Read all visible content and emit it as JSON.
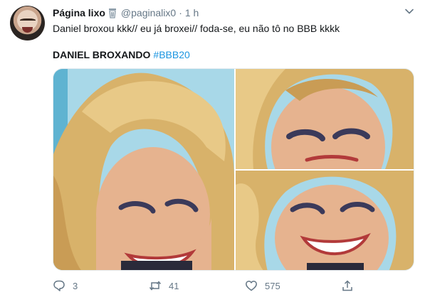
{
  "tweet": {
    "display_name": "Página lixo",
    "handle": "@paginalix0",
    "separator": "·",
    "time": "1 h",
    "text": "Daniel broxou kkk// eu já broxei// foda-se, eu não tô no BBB kkkk",
    "caption_bold": "DANIEL BROXANDO",
    "caption_hashtag": "#BBB20"
  },
  "actions": {
    "replies": "3",
    "retweets": "41",
    "likes": "575"
  },
  "icons": {
    "name_badge": "trash-can-icon",
    "menu": "chevron-down-icon",
    "reply": "reply-icon",
    "retweet": "retweet-icon",
    "like": "heart-icon",
    "share": "share-icon"
  },
  "colors": {
    "link": "#1b95e0",
    "secondary_text": "#657786",
    "primary_text": "#14171a"
  }
}
